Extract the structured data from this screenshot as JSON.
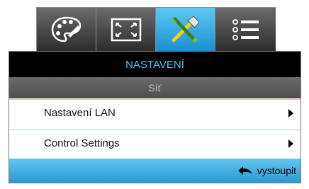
{
  "tabs": [
    {
      "icon": "palette-icon",
      "active": false
    },
    {
      "icon": "screen-resize-icon",
      "active": false
    },
    {
      "icon": "tools-icon",
      "active": true
    },
    {
      "icon": "list-icon",
      "active": false
    }
  ],
  "menu": {
    "title": "NASTAVENÍ",
    "subtitle": "Síť",
    "items": [
      {
        "label": "Nastavení LAN"
      },
      {
        "label": "Control Settings"
      }
    ],
    "exit_label": "vystoupit"
  },
  "colors": {
    "accent": "#4fc3f7",
    "tab_active": "#1b8fd0",
    "footer": "#2a9ad4"
  }
}
